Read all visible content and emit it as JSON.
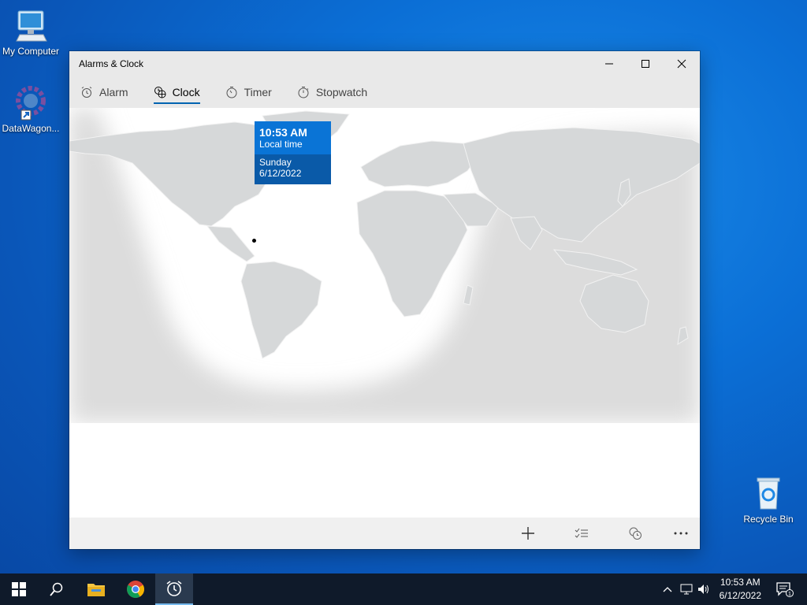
{
  "desktop": {
    "icons": [
      {
        "label": "My Computer"
      },
      {
        "label": "DataWagon..."
      },
      {
        "label": "Recycle Bin"
      }
    ]
  },
  "window": {
    "title": "Alarms & Clock",
    "tabs": [
      {
        "label": "Alarm",
        "icon": "alarm-icon",
        "active": false
      },
      {
        "label": "Clock",
        "icon": "world-clock-icon",
        "active": true
      },
      {
        "label": "Timer",
        "icon": "timer-icon",
        "active": false
      },
      {
        "label": "Stopwatch",
        "icon": "stopwatch-icon",
        "active": false
      }
    ],
    "location_tip": {
      "time": "10:53 AM",
      "subtitle": "Local time",
      "day": "Sunday",
      "date": "6/12/2022"
    },
    "appbar": {
      "buttons": [
        "add-icon",
        "select-list-icon",
        "compare-clocks-icon",
        "more-icon"
      ]
    }
  },
  "taskbar": {
    "items": [
      "start-icon",
      "search-icon",
      "file-explorer-icon",
      "chrome-icon",
      "alarms-clock-icon"
    ],
    "time": "10:53 AM",
    "date": "6/12/2022",
    "notification_count": "1"
  },
  "colors": {
    "accent": "#0063b1",
    "tip_top": "#0a74d6",
    "tip_bottom": "#0a5aa8",
    "taskbar": "#0f1a2a",
    "land": "#d9dcdd",
    "night": "#e3e3e3"
  }
}
